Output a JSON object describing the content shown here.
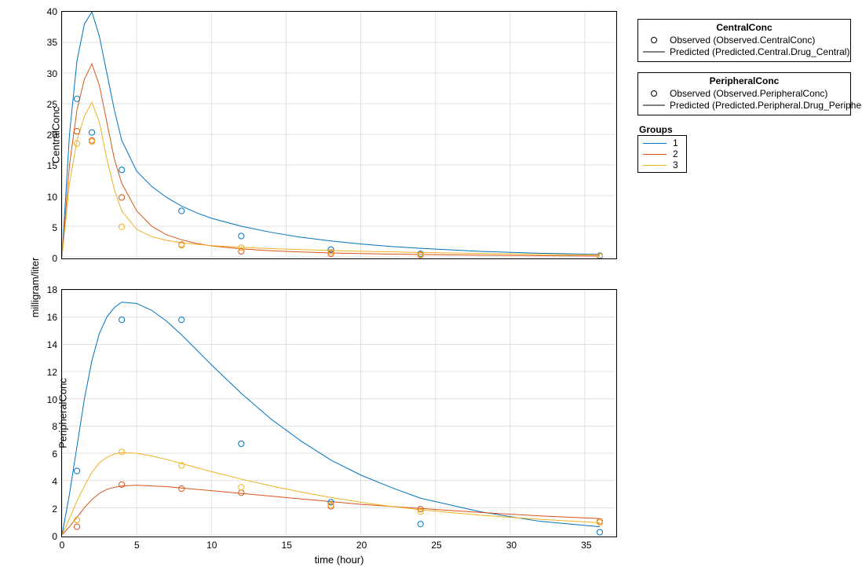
{
  "global_ylabel": "milligram/liter",
  "xlabel": "time (hour)",
  "colors": {
    "g1": "#0072BD",
    "g2": "#D95319",
    "g3": "#EDB120"
  },
  "legends": {
    "central": {
      "title": "CentralConc",
      "observed": "Observed (Observed.CentralConc)",
      "predicted": "Predicted (Predicted.Central.Drug_Central)"
    },
    "peripheral": {
      "title": "PeripheralConc",
      "observed": "Observed (Observed.PeripheralConc)",
      "predicted": "Predicted (Predicted.Peripheral.Drug_Peripheral)"
    },
    "groups": {
      "title": "Groups",
      "items": [
        "1",
        "2",
        "3"
      ]
    }
  },
  "chart_data": [
    {
      "name": "CentralConc",
      "type": "line",
      "title": "",
      "xlabel": "time (hour)",
      "ylabel": "CentralConc",
      "xlim": [
        0,
        37
      ],
      "ylim": [
        0,
        40
      ],
      "xticks": [
        0,
        5,
        10,
        15,
        20,
        25,
        30,
        35
      ],
      "yticks": [
        0,
        5,
        10,
        15,
        20,
        25,
        30,
        35,
        40
      ],
      "observed": {
        "x": [
          1,
          2,
          4,
          8,
          12,
          18,
          24,
          36
        ],
        "series": [
          {
            "name": "1",
            "values": [
              25.8,
              20.3,
              14.2,
              7.5,
              3.4,
              1.2,
              0.5,
              0.2
            ]
          },
          {
            "name": "2",
            "values": [
              20.5,
              19.0,
              9.7,
              2.0,
              0.9,
              0.5,
              0.3,
              0.1
            ]
          },
          {
            "name": "3",
            "values": [
              18.5,
              18.8,
              4.9,
              1.9,
              1.5,
              0.8,
              0.4,
              0.1
            ]
          }
        ]
      },
      "predicted": {
        "x": [
          0,
          0.5,
          1,
          1.5,
          2,
          2.5,
          3,
          3.5,
          4,
          5,
          6,
          7,
          8,
          9,
          10,
          12,
          14,
          16,
          18,
          20,
          22,
          24,
          28,
          32,
          36
        ],
        "series": [
          {
            "name": "1",
            "values": [
              0,
              20,
              32,
              38,
              40,
              36,
              30,
              24,
              19,
              14,
              11.5,
              9.7,
              8.3,
              7.2,
              6.3,
              5,
              4,
              3.2,
              2.6,
              2.1,
              1.7,
              1.4,
              0.9,
              0.6,
              0.4
            ]
          },
          {
            "name": "2",
            "values": [
              0,
              15,
              24,
              29,
              31.5,
              28,
              22,
              16,
              12,
              7.5,
              5,
              3.6,
              2.8,
              2.2,
              1.8,
              1.3,
              1,
              0.8,
              0.65,
              0.55,
              0.45,
              0.38,
              0.28,
              0.2,
              0.15
            ]
          },
          {
            "name": "3",
            "values": [
              0,
              12,
              19,
              23,
              25.2,
              22,
              16,
              11,
              7.5,
              4.5,
              3.3,
              2.7,
              2.3,
              2.05,
              1.85,
              1.55,
              1.35,
              1.18,
              1.05,
              0.92,
              0.82,
              0.72,
              0.55,
              0.42,
              0.32
            ]
          }
        ]
      }
    },
    {
      "name": "PeripheralConc",
      "type": "line",
      "title": "",
      "xlabel": "time (hour)",
      "ylabel": "PeripheralConc",
      "xlim": [
        0,
        37
      ],
      "ylim": [
        0,
        18
      ],
      "xticks": [
        0,
        5,
        10,
        15,
        20,
        25,
        30,
        35
      ],
      "yticks": [
        0,
        2,
        4,
        6,
        8,
        10,
        12,
        14,
        16,
        18
      ],
      "observed": {
        "x": [
          1,
          2,
          4,
          8,
          12,
          18,
          24,
          36
        ],
        "series": [
          {
            "name": "1",
            "values": [
              4.7,
              null,
              15.8,
              15.8,
              6.7,
              2.4,
              0.8,
              0.2
            ]
          },
          {
            "name": "2",
            "values": [
              0.6,
              null,
              3.7,
              3.4,
              3.1,
              2.1,
              1.9,
              1.0
            ]
          },
          {
            "name": "3",
            "values": [
              1.1,
              null,
              6.1,
              5.1,
              3.5,
              2.2,
              1.7,
              0.9
            ]
          }
        ]
      },
      "predicted": {
        "x": [
          0,
          0.5,
          1,
          1.5,
          2,
          2.5,
          3,
          3.5,
          4,
          5,
          6,
          7,
          8,
          9,
          10,
          12,
          14,
          16,
          18,
          20,
          22,
          24,
          28,
          32,
          36
        ],
        "series": [
          {
            "name": "1",
            "values": [
              0,
              3,
              6.5,
              10,
              12.8,
              14.8,
              16,
              16.7,
              17.1,
              17.0,
              16.5,
              15.7,
              14.7,
              13.6,
              12.5,
              10.4,
              8.5,
              6.9,
              5.5,
              4.4,
              3.5,
              2.7,
              1.7,
              1,
              0.6
            ]
          },
          {
            "name": "2",
            "values": [
              0,
              0.6,
              1.3,
              2,
              2.6,
              3.05,
              3.35,
              3.5,
              3.6,
              3.65,
              3.6,
              3.55,
              3.45,
              3.35,
              3.25,
              3.05,
              2.85,
              2.65,
              2.45,
              2.25,
              2.1,
              1.95,
              1.65,
              1.4,
              1.2
            ]
          },
          {
            "name": "3",
            "values": [
              0,
              1.2,
              2.5,
              3.6,
              4.6,
              5.3,
              5.7,
              5.95,
              6.05,
              6.0,
              5.8,
              5.55,
              5.25,
              4.95,
              4.65,
              4.1,
              3.6,
              3.15,
              2.75,
              2.4,
              2.1,
              1.85,
              1.45,
              1.15,
              0.9
            ]
          }
        ]
      }
    }
  ]
}
